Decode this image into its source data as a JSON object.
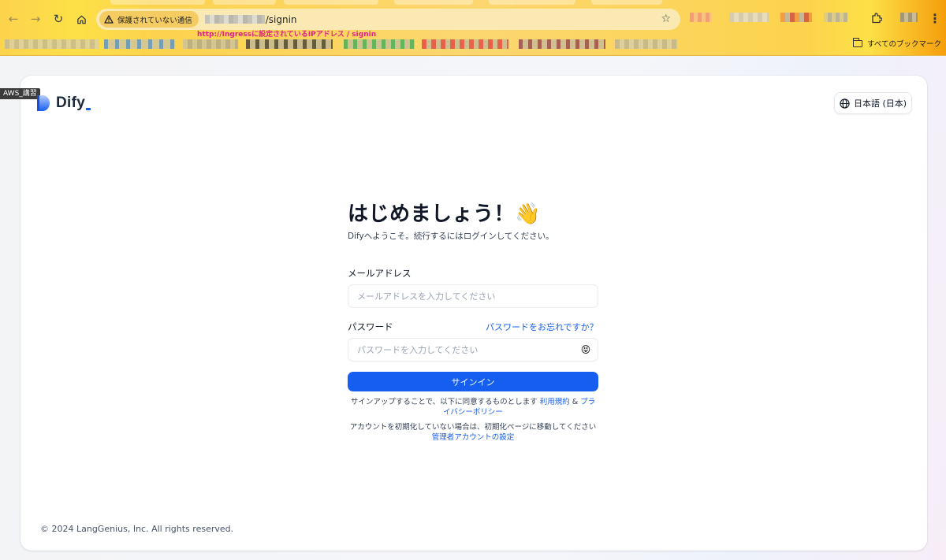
{
  "browser": {
    "security_chip": "保護されていない通信",
    "url_path": "/signin",
    "annotation": "http://Ingressに設定されているIPアドレス / signin",
    "bookmarks_all": "すべてのブックマーク"
  },
  "tag": {
    "label": "AWS_講習"
  },
  "header": {
    "logo_text": "Dify",
    "language_label": "日本語 (日本)"
  },
  "signin": {
    "heading": "はじめましょう！",
    "heading_emoji": "👋",
    "subtitle": "Difyへようこそ。続行するにはログインしてください。",
    "email_label": "メールアドレス",
    "email_placeholder": "メールアドレスを入力してください",
    "password_label": "パスワード",
    "forgot_link": "パスワードをお忘れですか？",
    "password_placeholder": "パスワードを入力してください",
    "password_toggle_emoji": "😝",
    "signin_button": "サインイン",
    "terms_prefix": "サインアップすることで、以下に同意するものとします ",
    "terms_link": "利用規約",
    "terms_amp": " & ",
    "privacy_link": "プライバシーポリシー",
    "admin_prefix": "アカウントを初期化していない場合は、初期化ページに移動してください ",
    "admin_link": "管理者アカウントの設定"
  },
  "footer": {
    "copyright": "© 2024 LangGenius, Inc. All rights reserved."
  }
}
